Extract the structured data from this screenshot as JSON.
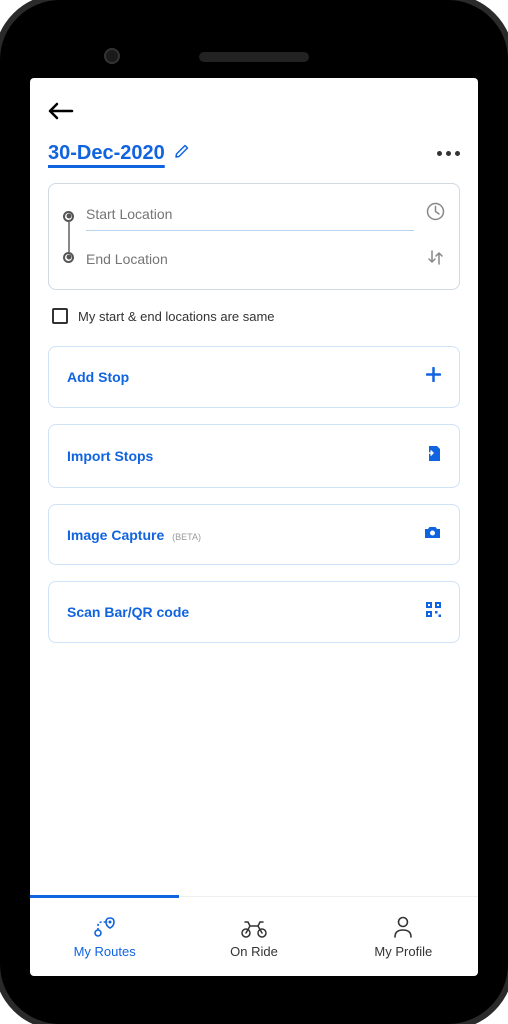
{
  "header": {
    "date": "30-Dec-2020"
  },
  "locations": {
    "start_placeholder": "Start Location",
    "end_placeholder": "End Location",
    "same_label": "My start & end locations are same"
  },
  "actions": {
    "add_stop": "Add Stop",
    "import_stops": "Import Stops",
    "image_capture": "Image Capture",
    "image_capture_beta": "(BETA)",
    "scan_code": "Scan Bar/QR code"
  },
  "tabs": {
    "my_routes": "My Routes",
    "on_ride": "On Ride",
    "my_profile": "My Profile"
  }
}
